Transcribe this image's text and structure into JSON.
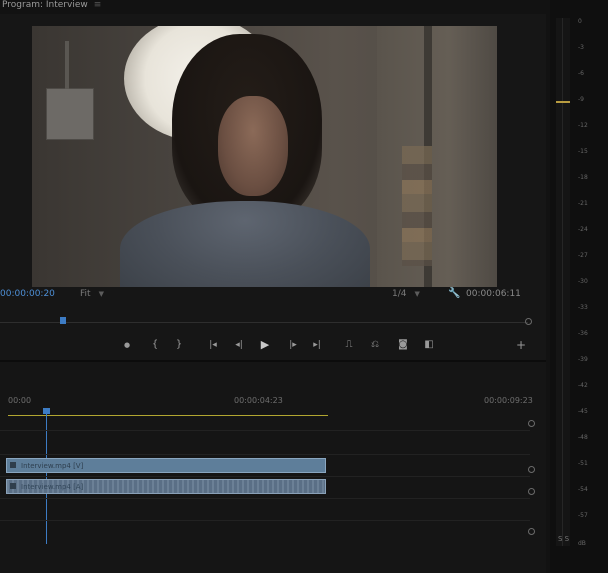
{
  "monitor": {
    "tab_title": "Program: Interview",
    "tab_close": "≡",
    "timecode_current": "00:00:00:20",
    "fit_label": "Fit",
    "quality_label": "1/4",
    "timecode_duration": "00:00:06:11",
    "transport": {
      "add_marker": "●",
      "mark_in": "{",
      "mark_out": "}",
      "go_to_in": "|◂",
      "step_back": "◂|",
      "play": "▶",
      "step_forward": "|▸",
      "go_to_out": "▸|",
      "lift": "⎍",
      "extract": "⎌",
      "export_frame": "◙",
      "comparison_view": "◧",
      "button_editor": "+"
    }
  },
  "timeline": {
    "ruler": [
      "00:00",
      "00:00:04:23",
      "00:00:09:23"
    ],
    "clips": {
      "video": "Interview.mp4 [V]",
      "audio": "Interview.mp4 [A]"
    }
  },
  "audio_meter": {
    "scale": [
      "0",
      "-3",
      "-6",
      "-9",
      "-12",
      "-15",
      "-18",
      "-21",
      "-24",
      "-27",
      "-30",
      "-33",
      "-36",
      "-39",
      "-42",
      "-45",
      "-48",
      "-51",
      "-54",
      "-57",
      "dB"
    ],
    "solo": "S S",
    "peak_color": "#b89c40"
  },
  "colors": {
    "accent_blue": "#3d7cc4",
    "work_area": "#b2a630",
    "clip_blue": "#5e7e9a"
  }
}
